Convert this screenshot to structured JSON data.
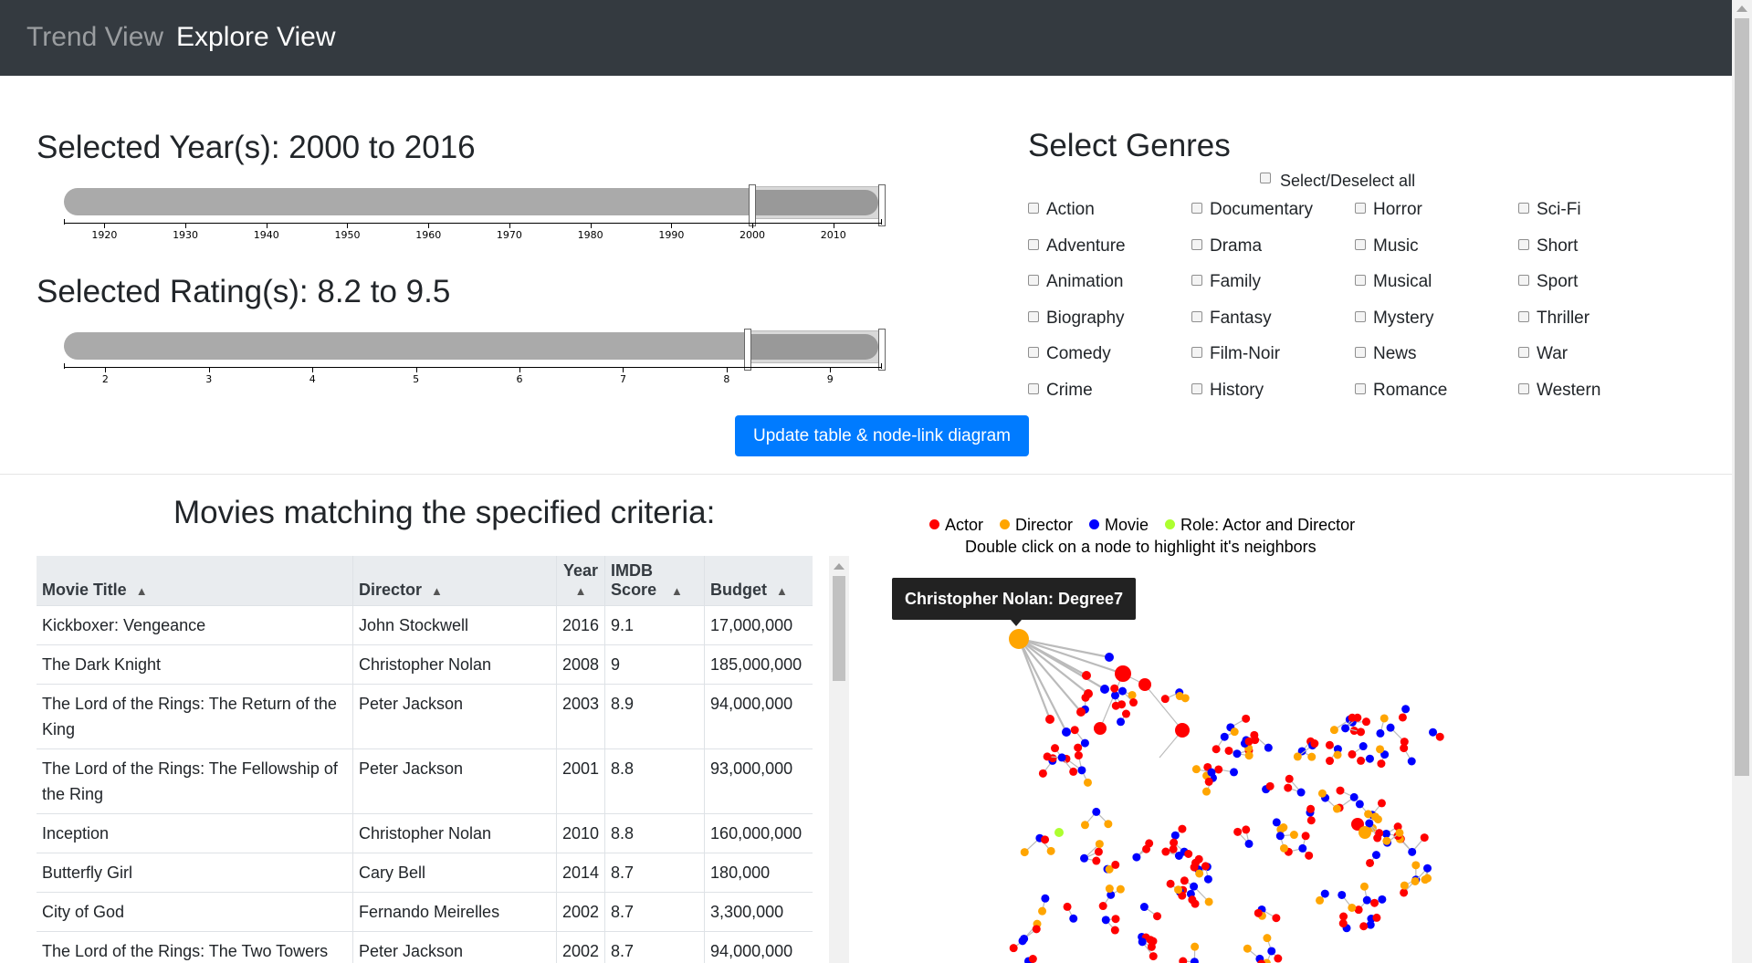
{
  "nav": {
    "trend": "Trend View",
    "explore": "Explore View"
  },
  "year_filter": {
    "title": "Selected Year(s): 2000 to 2016",
    "min": 1915,
    "max": 2016,
    "sel_lo": 2000,
    "sel_hi": 2016,
    "ticks": [
      1920,
      1930,
      1940,
      1950,
      1960,
      1970,
      1980,
      1990,
      2000,
      2010
    ]
  },
  "rating_filter": {
    "title": "Selected Rating(s): 8.2 to 9.5",
    "min": 1.6,
    "max": 9.5,
    "sel_lo": 8.2,
    "sel_hi": 9.5,
    "ticks": [
      2,
      3,
      4,
      5,
      6,
      7,
      8,
      9
    ]
  },
  "genres": {
    "title": "Select Genres",
    "select_all": "Select/Deselect all",
    "columns": [
      [
        "Action",
        "Adventure",
        "Animation",
        "Biography",
        "Comedy",
        "Crime"
      ],
      [
        "Documentary",
        "Drama",
        "Family",
        "Fantasy",
        "Film-Noir",
        "History"
      ],
      [
        "Horror",
        "Music",
        "Musical",
        "Mystery",
        "News",
        "Romance"
      ],
      [
        "Sci-Fi",
        "Short",
        "Sport",
        "Thriller",
        "War",
        "Western"
      ]
    ]
  },
  "update_button": "Update table & node-link diagram",
  "movies": {
    "title": "Movies matching the specified criteria:",
    "headers": [
      "Movie Title",
      "Director",
      "Year",
      "IMDB Score",
      "Budget"
    ],
    "rows": [
      [
        "Kickboxer: Vengeance",
        "John Stockwell",
        "2016",
        "9.1",
        "17,000,000"
      ],
      [
        "The Dark Knight",
        "Christopher Nolan",
        "2008",
        "9",
        "185,000,000"
      ],
      [
        "The Lord of the Rings: The Return of the King",
        "Peter Jackson",
        "2003",
        "8.9",
        "94,000,000"
      ],
      [
        "The Lord of the Rings: The Fellowship of the Ring",
        "Peter Jackson",
        "2001",
        "8.8",
        "93,000,000"
      ],
      [
        "Inception",
        "Christopher Nolan",
        "2010",
        "8.8",
        "160,000,000"
      ],
      [
        "Butterfly Girl",
        "Cary Bell",
        "2014",
        "8.7",
        "180,000"
      ],
      [
        "City of God",
        "Fernando Meirelles",
        "2002",
        "8.7",
        "3,300,000"
      ],
      [
        "The Lord of the Rings: The Two Towers",
        "Peter Jackson",
        "2002",
        "8.7",
        "94,000,000"
      ]
    ]
  },
  "graph": {
    "legend": [
      {
        "label": "Actor",
        "color": "#ff0000"
      },
      {
        "label": "Director",
        "color": "#ffa500"
      },
      {
        "label": "Movie",
        "color": "#0000ff"
      },
      {
        "label": "Role: Actor and Director",
        "color": "#adff2f"
      }
    ],
    "hint": "Double click on a node to highlight it's neighbors",
    "tooltip": "Christopher Nolan: Degree7"
  }
}
